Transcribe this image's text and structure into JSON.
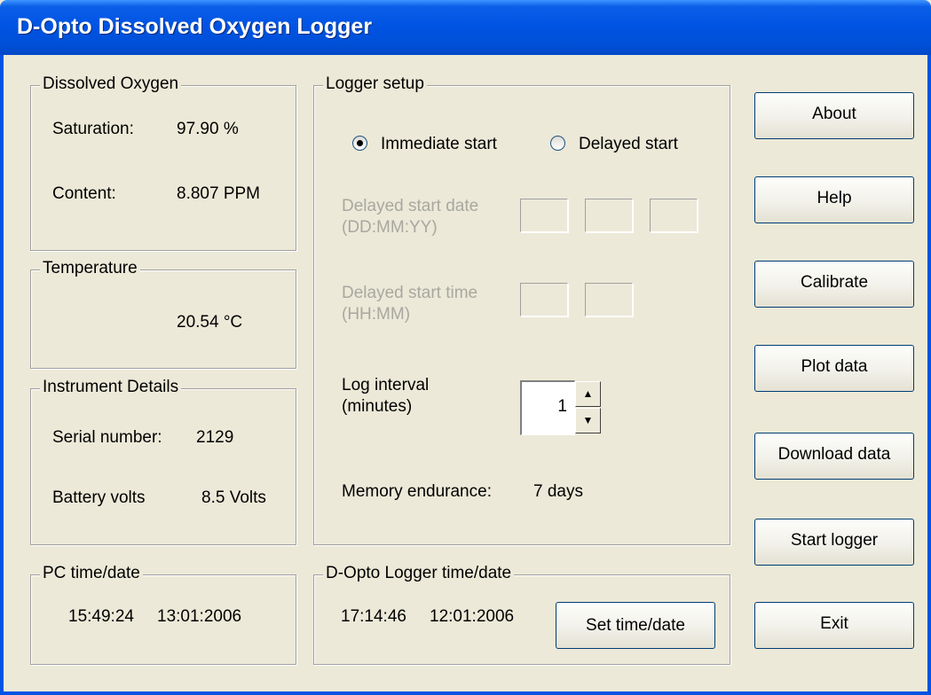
{
  "window": {
    "title": "D-Opto Dissolved Oxygen Logger"
  },
  "dissolved_oxygen": {
    "legend": "Dissolved Oxygen",
    "saturation_label": "Saturation:",
    "saturation_value": "97.90 %",
    "content_label": "Content:",
    "content_value": "8.807 PPM"
  },
  "temperature": {
    "legend": "Temperature",
    "value": "20.54 °C"
  },
  "instrument": {
    "legend": "Instrument Details",
    "serial_label": "Serial number:",
    "serial_value": "2129",
    "battery_label": "Battery volts",
    "battery_value": "8.5 Volts"
  },
  "pc_time": {
    "legend": "PC time/date",
    "time": "15:49:24",
    "date": "13:01:2006"
  },
  "logger_setup": {
    "legend": "Logger setup",
    "immediate_label": "Immediate start",
    "delayed_label": "Delayed start",
    "selected": "immediate",
    "delayed_date_label1": "Delayed start date",
    "delayed_date_label2": "(DD:MM:YY)",
    "delayed_time_label1": "Delayed start time",
    "delayed_time_label2": "(HH:MM)",
    "log_interval_label1": "Log interval",
    "log_interval_label2": "(minutes)",
    "log_interval_value": "1",
    "memory_label": "Memory endurance:",
    "memory_value": "7 days"
  },
  "logger_time": {
    "legend": "D-Opto Logger time/date",
    "time": "17:14:46",
    "date": "12:01:2006",
    "set_button": "Set time/date"
  },
  "buttons": {
    "about": "About",
    "help": "Help",
    "calibrate": "Calibrate",
    "plot": "Plot data",
    "download": "Download data",
    "start": "Start logger",
    "exit": "Exit"
  },
  "icons": {
    "spin_up": "spin-up-arrow-icon",
    "spin_down": "spin-down-arrow-icon"
  }
}
